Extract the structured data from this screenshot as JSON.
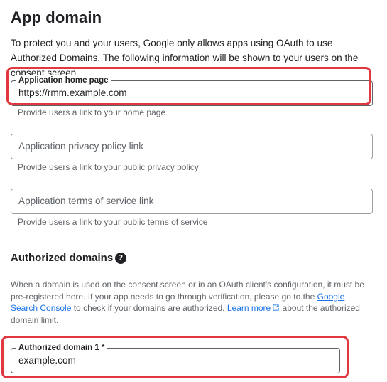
{
  "page": {
    "title": "App domain",
    "intro": "To protect you and your users, Google only allows apps using OAuth to use Authorized Domains. The following information will be shown to your users on the consent screen."
  },
  "fields": {
    "home_page": {
      "label": "Application home page",
      "value": "https://rmm.example.com",
      "helper": "Provide users a link to your home page"
    },
    "privacy": {
      "placeholder": "Application privacy policy link",
      "helper": "Provide users a link to your public privacy policy"
    },
    "terms": {
      "placeholder": "Application terms of service link",
      "helper": "Provide users a link to your public terms of service"
    }
  },
  "authorized": {
    "title": "Authorized domains",
    "help_icon": "question-circle-icon",
    "desc_part1": "When a domain is used on the consent screen or in an OAuth client's configuration, it must be pre-registered here. If your app needs to go through verification, please go to the ",
    "search_console_link": "Google Search Console",
    "desc_part2": " to check if your domains are authorized. ",
    "learn_more_link": "Learn more",
    "desc_part3": " about the authorized domain limit.",
    "domain1": {
      "label": "Authorized domain 1 *",
      "value": "example.com"
    }
  },
  "colors": {
    "highlight": "#e0383e",
    "link": "#1a73e8"
  }
}
